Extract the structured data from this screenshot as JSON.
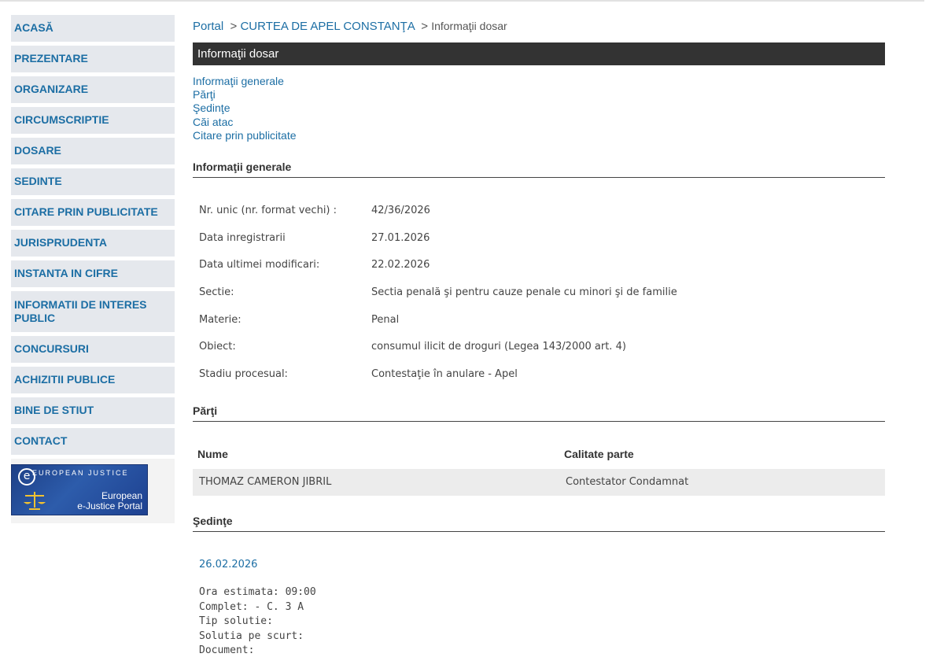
{
  "sidebar": {
    "items": [
      {
        "label": "ACASĂ"
      },
      {
        "label": "PREZENTARE"
      },
      {
        "label": "ORGANIZARE"
      },
      {
        "label": "CIRCUMSCRIPTIE"
      },
      {
        "label": "DOSARE"
      },
      {
        "label": "SEDINTE"
      },
      {
        "label": "CITARE PRIN PUBLICITATE"
      },
      {
        "label": "JURISPRUDENTA"
      },
      {
        "label": "INSTANTA IN CIFRE"
      },
      {
        "label": "INFORMATII DE INTERES PUBLIC"
      },
      {
        "label": "CONCURSURI"
      },
      {
        "label": "ACHIZITII PUBLICE"
      },
      {
        "label": "BINE DE STIUT"
      },
      {
        "label": "CONTACT"
      }
    ],
    "ejustice": {
      "letter": "e",
      "small_text": "EUROPEAN JUSTICE",
      "line1": "European",
      "line2": "e-Justice Portal"
    }
  },
  "breadcrumb": {
    "portal": "Portal",
    "sep": ">",
    "court": "CURTEA DE APEL CONSTANŢA",
    "current": "Informaţii dosar"
  },
  "title_bar": "Informaţii dosar",
  "quick_links": [
    "Informaţii generale",
    "Părţi",
    "Şedinţe",
    "Căi atac",
    "Citare prin publicitate"
  ],
  "general": {
    "heading": "Informaţii generale",
    "rows": [
      {
        "label": "Nr. unic (nr. format vechi) :",
        "value": "42/36/2026"
      },
      {
        "label": "Data inregistrarii",
        "value": "27.01.2026"
      },
      {
        "label": "Data ultimei modificari:",
        "value": "22.02.2026"
      },
      {
        "label": "Sectie:",
        "value": "Sectia penală şi pentru cauze penale cu minori şi de familie"
      },
      {
        "label": "Materie:",
        "value": "Penal"
      },
      {
        "label": "Obiect:",
        "value": "consumul ilicit de droguri (Legea 143/2000 art. 4)"
      },
      {
        "label": "Stadiu procesual:",
        "value": "Contestaţie în anulare - Apel"
      }
    ]
  },
  "parts": {
    "heading": "Părţi",
    "columns": [
      "Nume",
      "Calitate parte"
    ],
    "rows": [
      {
        "name": "THOMAZ CAMERON JIBRIL",
        "role": "Contestator Condamnat"
      }
    ]
  },
  "hearings": {
    "heading": "Şedinţe",
    "date": "26.02.2026",
    "details": [
      "Ora estimata: 09:00",
      "Complet: - C. 3 A",
      "Tip solutie:",
      "Solutia pe scurt:",
      "Document:"
    ]
  }
}
